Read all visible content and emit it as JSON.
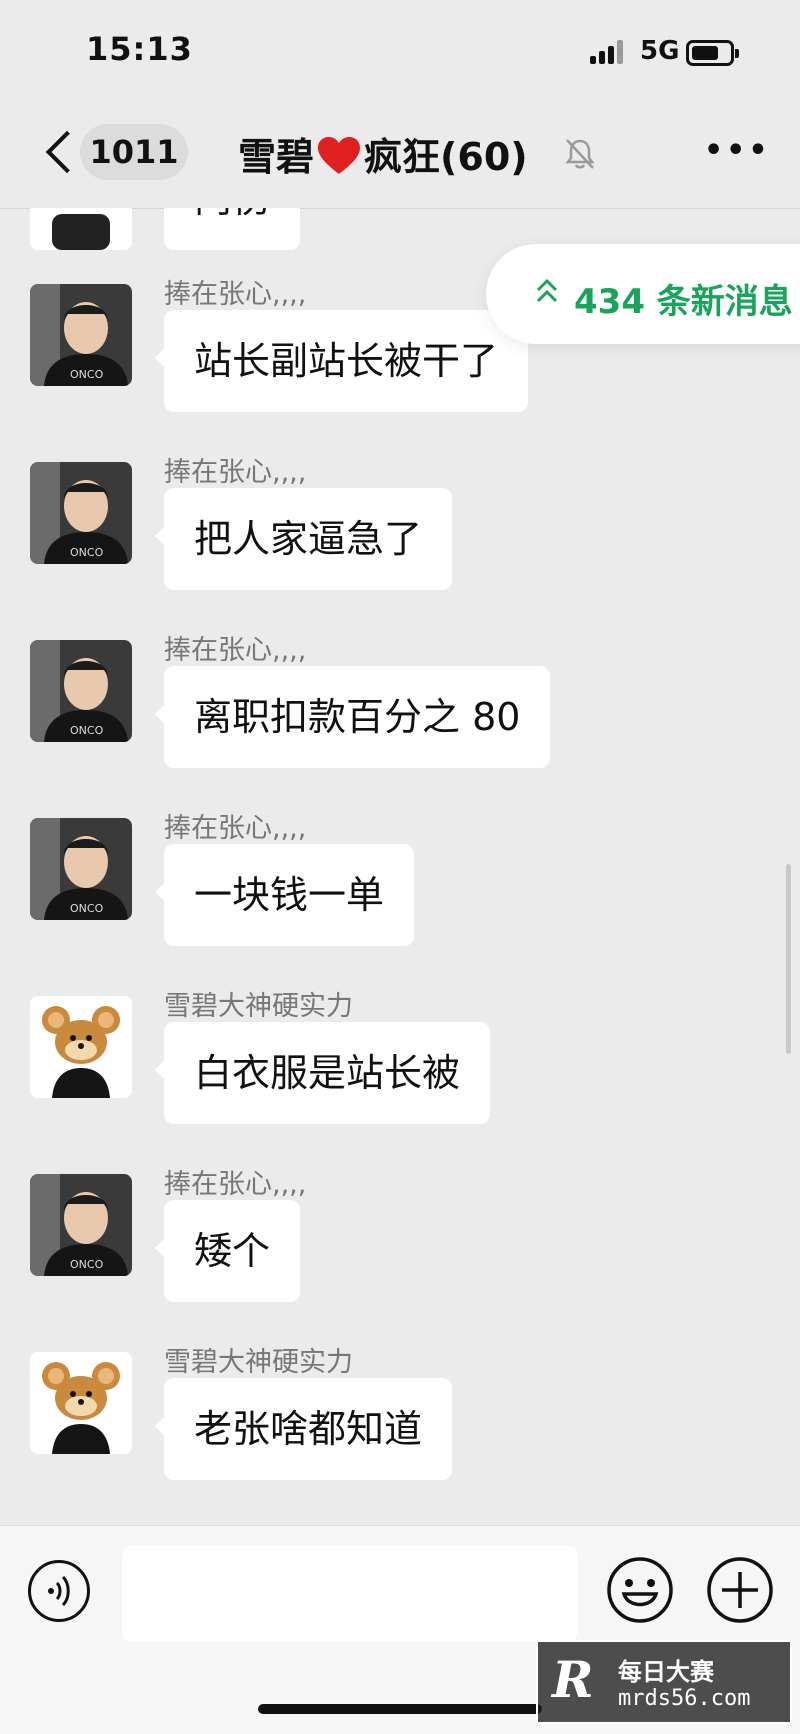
{
  "status_bar": {
    "time": "15:13",
    "network": "5G"
  },
  "nav": {
    "unread_count": "1011",
    "title_prefix": "雪碧",
    "title_suffix": "疯狂(60)"
  },
  "new_messages_banner": "434 条新消息",
  "messages": [
    {
      "sender": "",
      "text": "内伤",
      "avatar": "man"
    },
    {
      "sender": "捧在张心,,,,",
      "text": "站长副站长被干了",
      "avatar": "man"
    },
    {
      "sender": "捧在张心,,,,",
      "text": "把人家逼急了",
      "avatar": "man"
    },
    {
      "sender": "捧在张心,,,,",
      "text": "离职扣款百分之 80",
      "avatar": "man"
    },
    {
      "sender": "捧在张心,,,,",
      "text": "一块钱一单",
      "avatar": "man"
    },
    {
      "sender": "雪碧大神硬实力",
      "text": "白衣服是站长被",
      "avatar": "mouse"
    },
    {
      "sender": "捧在张心,,,,",
      "text": "矮个",
      "avatar": "man"
    },
    {
      "sender": "雪碧大神硬实力",
      "text": "老张啥都知道",
      "avatar": "mouse"
    }
  ],
  "input": {
    "value": "",
    "placeholder": ""
  },
  "watermark": {
    "logo": "R",
    "line1": "每日大赛",
    "line2": "mrds56.com"
  },
  "colors": {
    "accent_green": "#1aa35a",
    "heart": "#e02020",
    "bubble": "#ffffff",
    "background": "#ebebeb"
  }
}
